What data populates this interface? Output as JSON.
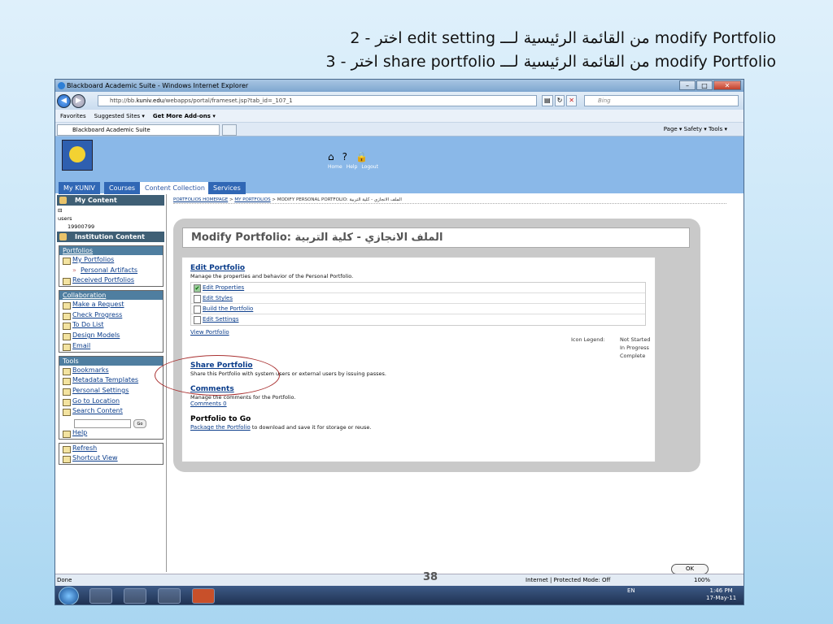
{
  "slide": {
    "line1": "2 - اختر edit setting من القائمة الرئيسية لـــ modify Portfolio",
    "line2": "3 - اختر share portfolio من القائمة الرئيسية لـــ modify Portfolio",
    "page_number": "38"
  },
  "browser": {
    "window_title": "Blackboard Academic Suite - Windows Internet Explorer",
    "url_prefix": "http://bb.",
    "url_host": "kuniv.edu",
    "url_rest": "/webapps/portal/frameset.jsp?tab_id=_107_1",
    "search_placeholder": "Bing",
    "favorites": "Favorites",
    "suggested_sites": "Suggested Sites ▾",
    "get_addons": "Get More Add-ons ▾",
    "tab_title": "Blackboard Academic Suite",
    "command_bar": "Page ▾  Safety ▾  Tools ▾",
    "status": "Done",
    "zone": "Internet | Protected Mode: Off",
    "zoom": "100%"
  },
  "bb_header": {
    "links": [
      "Home",
      "Help",
      "Logout"
    ],
    "tabs": [
      "My KUNIV",
      "Courses",
      "Content Collection",
      "Services"
    ]
  },
  "leftnav": {
    "my_content": "My Content",
    "tree_items": [
      "users",
      "19900799"
    ],
    "institution_content": "Institution Content",
    "portfolios": {
      "head": "Portfolios",
      "items": [
        "My Portfolios",
        "Personal Artifacts",
        "Received Portfolios"
      ]
    },
    "collaboration": {
      "head": "Collaboration",
      "items": [
        "Make a Request",
        "Check Progress",
        "To Do List",
        "Design Models",
        "Email"
      ]
    },
    "tools": {
      "head": "Tools",
      "items": [
        "Bookmarks",
        "Metadata Templates",
        "Personal Settings",
        "Go to Location",
        "Search Content"
      ],
      "go": "Go",
      "help": "Help"
    },
    "bottom": [
      "Refresh",
      "Shortcut View"
    ]
  },
  "content": {
    "crumb_home": "PORTFOLIOS HOMEPAGE",
    "crumb_my": "MY PORTFOLIOS",
    "crumb_rest": "MODIFY PERSONAL PORTFOLIO: الملف الانجازي - كلية التربية",
    "page_title": "Modify Portfolio: الملف الانجازي - كلية التربية",
    "edit": {
      "title": "Edit Portfolio",
      "desc": "Manage the properties and behavior of the Personal Portfolio.",
      "steps": [
        "Edit Properties",
        "Edit Styles",
        "Build the Portfolio",
        "Edit Settings"
      ],
      "view": "View Portfolio"
    },
    "legend": {
      "label": "Icon Legend:",
      "items": [
        "Not Started",
        "In Progress",
        "Complete"
      ]
    },
    "share": {
      "title": "Share Portfolio",
      "desc": "Share this Portfolio with system users or external users by issuing passes."
    },
    "comments": {
      "title": "Comments",
      "desc": "Manage the comments for the Portfolio.",
      "link": "Comments 0"
    },
    "togo": {
      "title": "Portfolio to Go",
      "link": "Package the Portfolio",
      "desc": " to download and save it for storage or reuse."
    },
    "ok": "OK"
  },
  "taskbar": {
    "lang": "EN",
    "time": "1:46 PM",
    "date": "17-May-11"
  }
}
